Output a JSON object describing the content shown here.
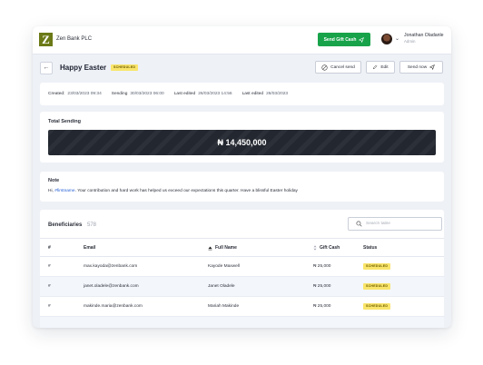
{
  "header": {
    "bank_name": "Zen Bank PLC",
    "logo_letter": "Z",
    "send_gift_cash_label": "Send Gift Cash",
    "user_name": "Jonathan Oladanle",
    "user_role": "Admin"
  },
  "page": {
    "title": "Happy Easter",
    "status_badge": "SCHEDULED",
    "actions": {
      "cancel_send": "Cancel send",
      "edit": "Edit",
      "send_now": "Send now"
    }
  },
  "meta": {
    "created_label": "Created:",
    "created_value": "23/03/2023 09:34",
    "sending_label": "Sending",
    "sending_value": "30/03/2023 06:00",
    "last_edited_label": "Last edited",
    "last_edited_value": "26/03/2023 14:56",
    "last_edited_label_2": "Last edited",
    "last_edited_value_2": "26/03/2023"
  },
  "total": {
    "label": "Total Sending",
    "amount": "₦ 14,450,000"
  },
  "note": {
    "label": "Note",
    "greeting": "Hi, ",
    "variable": "#firstname",
    "body": ". Your contribution and hard work has helped us exceed our expectations this quarter. Have a blissful Easter holiday"
  },
  "beneficiaries": {
    "label": "Beneficiaries",
    "count": "578",
    "search_placeholder": "Search table",
    "columns": {
      "index": "#",
      "email": "Email",
      "full_name": "Full Name",
      "gift_cash": "Gift Cash",
      "status": "Status"
    },
    "rows": [
      {
        "index": "#",
        "email": "max.kayoda@zenbank.com",
        "full_name": "Kayode Maxwell",
        "gift_cash": "₦ 25,000",
        "status": "SCHEDULED"
      },
      {
        "index": "#",
        "email": "janet.oladele@zenbank.com",
        "full_name": "Janet Oladele",
        "gift_cash": "₦ 25,000",
        "status": "SCHEDULED"
      },
      {
        "index": "#",
        "email": "makinde.maria@zenbank.com",
        "full_name": "Mariah Makinde",
        "gift_cash": "₦ 25,000",
        "status": "SCHEDULED"
      }
    ]
  },
  "colors": {
    "brand_green": "#18a34a",
    "logo_olive": "#6b7a17",
    "badge_yellow": "#f9e56b",
    "banner_dark": "#23272f",
    "link_blue": "#2962d6"
  }
}
